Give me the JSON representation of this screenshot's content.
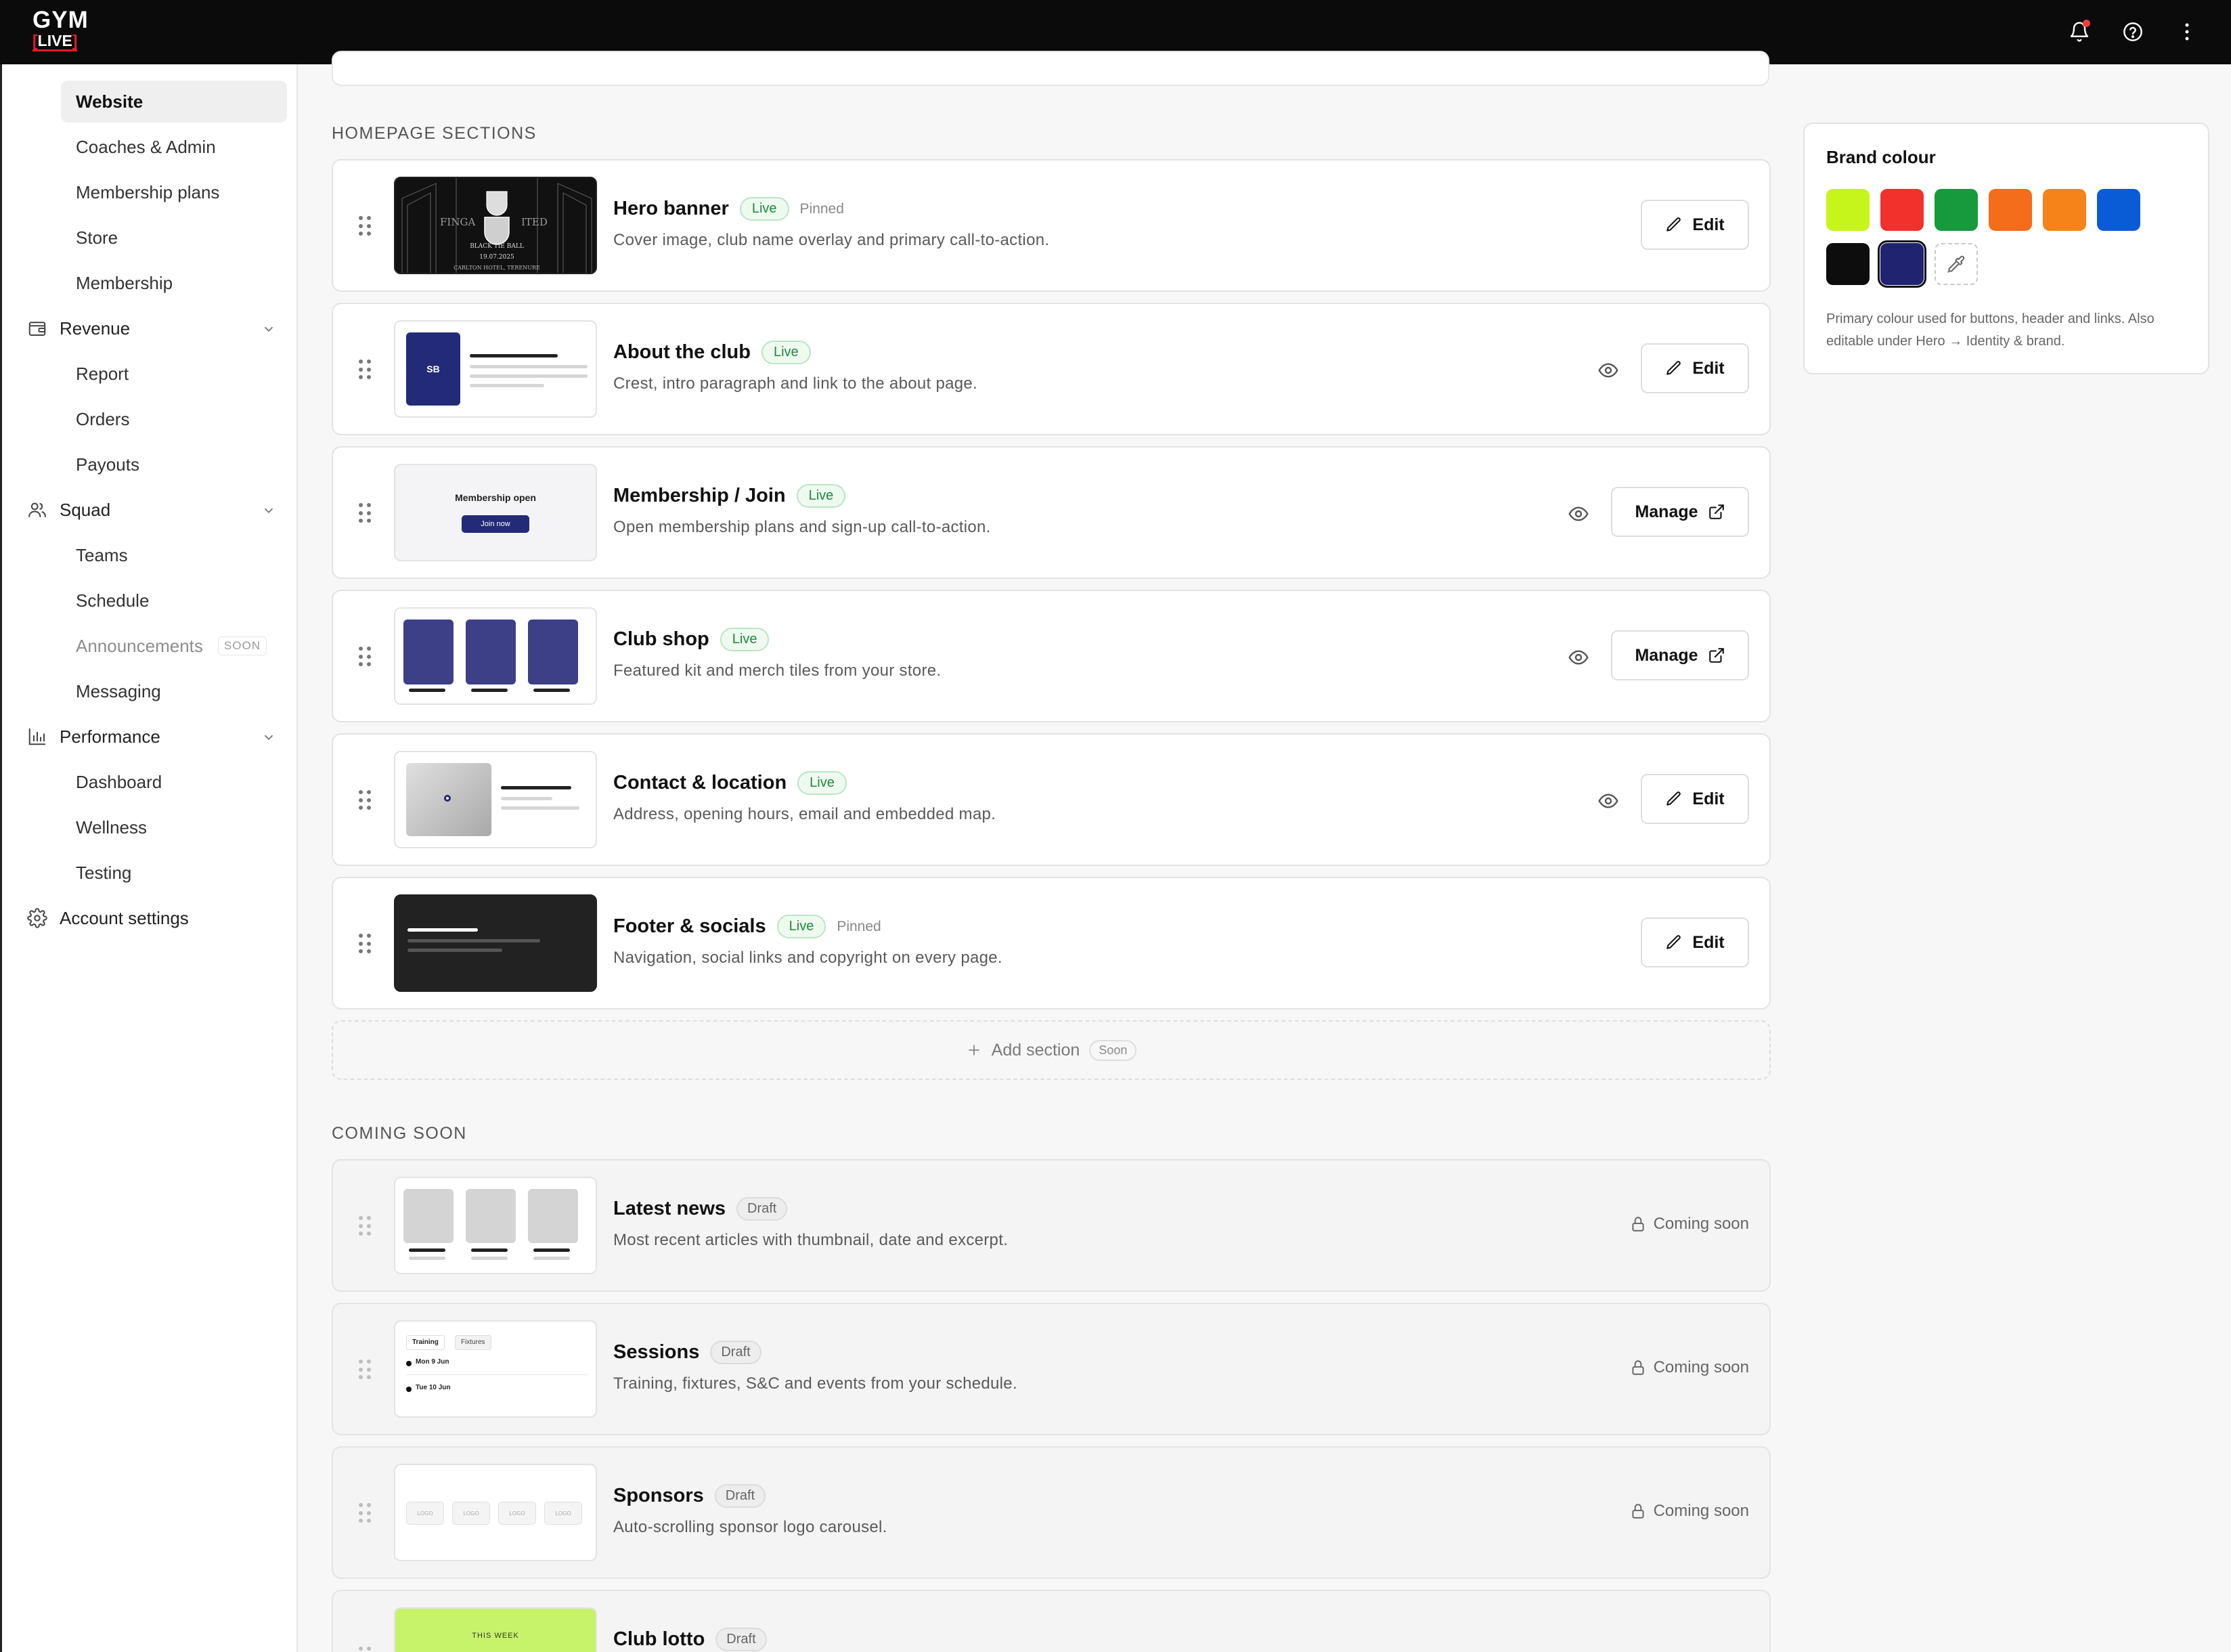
{
  "app": {
    "logo_top": "GYM",
    "logo_bottom_open": "[",
    "logo_bottom_text": "LIVE",
    "logo_bottom_close": "]"
  },
  "topbar_icons": [
    "bell-icon",
    "help-icon",
    "more-vertical-icon"
  ],
  "sidebar": {
    "items": [
      {
        "label": "Website",
        "active": true
      },
      {
        "label": "Coaches & Admin"
      },
      {
        "label": "Membership plans"
      },
      {
        "label": "Store"
      },
      {
        "label": "Membership"
      }
    ],
    "groups": [
      {
        "label": "Revenue",
        "icon": "wallet-icon",
        "children": [
          "Report",
          "Orders",
          "Payouts"
        ]
      },
      {
        "label": "Squad",
        "icon": "users-icon",
        "children": [
          "Teams",
          "Schedule",
          "Announcements",
          "Messaging"
        ],
        "soon_label": "SOON"
      },
      {
        "label": "Performance",
        "icon": "bar-chart-icon",
        "children": [
          "Dashboard",
          "Wellness",
          "Testing"
        ]
      }
    ],
    "account_settings": "Account settings"
  },
  "homepage": {
    "title": "HOMEPAGE SECTIONS",
    "sections": [
      {
        "title": "Hero banner",
        "status": "Live",
        "pinned": "Pinned",
        "desc": "Cover image, club name overlay and primary call-to-action.",
        "action": "Edit"
      },
      {
        "title": "About the club",
        "status": "Live",
        "desc": "Crest, intro paragraph and link to the about page.",
        "action": "Edit",
        "crest": "SB"
      },
      {
        "title": "Membership / Join",
        "status": "Live",
        "desc": "Open membership plans and sign-up call-to-action.",
        "action": "Manage",
        "thumb_title": "Membership open",
        "thumb_button": "Join now"
      },
      {
        "title": "Club shop",
        "status": "Live",
        "desc": "Featured kit and merch tiles from your store.",
        "action": "Manage"
      },
      {
        "title": "Contact & location",
        "status": "Live",
        "desc": "Address, opening hours, email and embedded map.",
        "action": "Edit"
      },
      {
        "title": "Footer & socials",
        "status": "Live",
        "pinned": "Pinned",
        "desc": "Navigation, social links and copyright on every page.",
        "action": "Edit"
      }
    ],
    "add_section": "Add section",
    "add_section_soon": "Soon"
  },
  "coming_soon": {
    "title": "COMING SOON",
    "sections": [
      {
        "title": "Latest news",
        "status": "Draft",
        "desc": "Most recent articles with thumbnail, date and excerpt.",
        "state": "Coming soon"
      },
      {
        "title": "Sessions",
        "status": "Draft",
        "desc": "Training, fixtures, S&C and events from your schedule.",
        "state": "Coming soon",
        "tabs": [
          "Training",
          "Fixtures"
        ],
        "dates": [
          "Mon 9 Jun",
          "Tue 10 Jun"
        ]
      },
      {
        "title": "Sponsors",
        "status": "Draft",
        "desc": "Auto-scrolling sponsor logo carousel.",
        "state": "Coming soon",
        "logo_label": "LOGO"
      },
      {
        "title": "Club lotto",
        "status": "Draft",
        "thumb_label": "THIS WEEK"
      }
    ]
  },
  "hero_thumb": {
    "line1": "BLACK TIE BALL",
    "line2": "19.07.2025",
    "line3": "CARLTON HOTEL, TERENURE",
    "word_left": "FINGA",
    "word_right": "ITED"
  },
  "brand": {
    "title": "Brand colour",
    "colors": [
      "#c6f51b",
      "#f2312d",
      "#179a3d",
      "#f36d1b",
      "#f6831a",
      "#0a5bd6",
      "#0d0d0d",
      "#1f2370"
    ],
    "selected": "#1f2370",
    "desc": "Primary colour used for buttons, header and links. Also editable under Hero → Identity & brand."
  }
}
